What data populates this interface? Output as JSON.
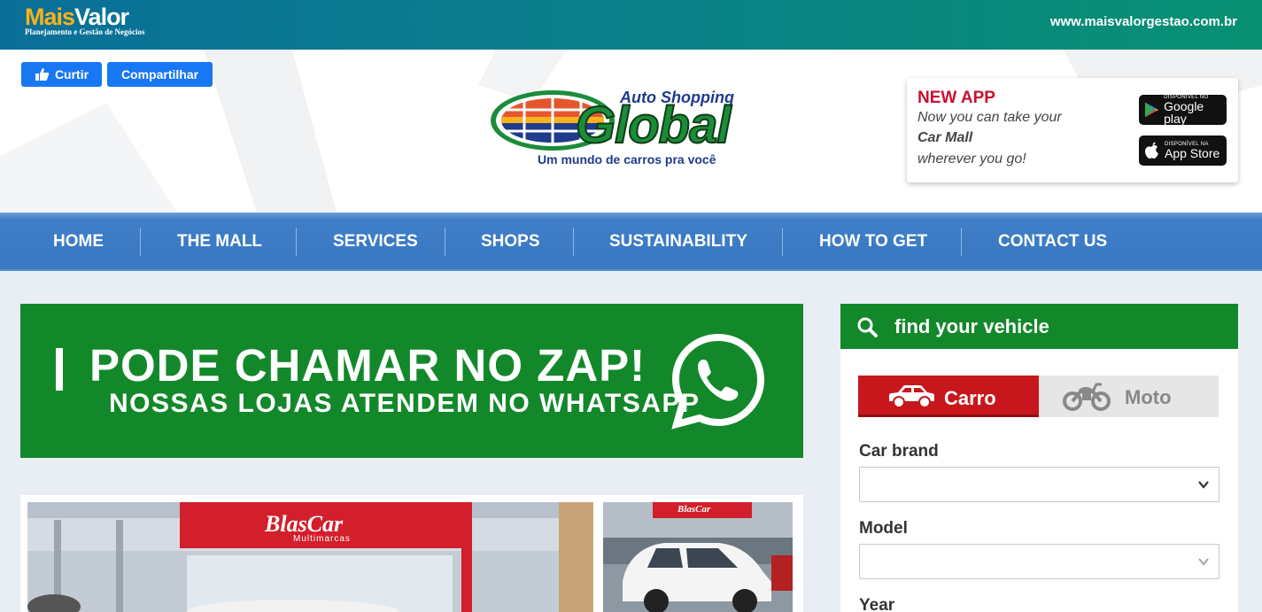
{
  "topbar": {
    "logo_mais": "Mais",
    "logo_valor": "Valor",
    "logo_sub": "Planejamento e Gestão de Negócios",
    "url": "www.maisvalorgestao.com.br"
  },
  "social": {
    "like_label": "Curtir",
    "share_label": "Compartilhar"
  },
  "brand": {
    "auto_shopping": "Auto Shopping",
    "name": "Global",
    "tagline": "Um mundo de carros pra você"
  },
  "app_promo": {
    "title": "NEW APP",
    "line1": "Now you can take your",
    "line2": "Car Mall",
    "line3": "wherever you go!",
    "google_small": "DISPONÍVEL NO",
    "google_big": "Google play",
    "apple_small": "DISPONÍVEL NA",
    "apple_big": "App Store"
  },
  "nav": {
    "items": [
      {
        "label": "HOME"
      },
      {
        "label": "THE MALL"
      },
      {
        "label": "SERVICES"
      },
      {
        "label": "SHOPS"
      },
      {
        "label": "SUSTAINABILITY"
      },
      {
        "label": "HOW TO GET"
      },
      {
        "label": "CONTACT US"
      }
    ]
  },
  "banner": {
    "headline": "PODE CHAMAR NO ZAP!",
    "subline": "NOSSAS LOJAS ATENDEM NO WHATSAPP"
  },
  "photos": {
    "store_sign": "BlasCar",
    "store_sign_sub": "Multimarcas",
    "store_sign_small": "BlasCar"
  },
  "search": {
    "title": "find your vehicle",
    "tab_car": "Carro",
    "tab_moto": "Moto",
    "brand_label": "Car brand",
    "brand_value": "",
    "model_label": "Model",
    "model_value": "",
    "year_label": "Year"
  },
  "colors": {
    "green": "#13882b",
    "nav_blue": "#3a78c2",
    "red": "#c8161d",
    "fb_blue": "#1877f2"
  }
}
